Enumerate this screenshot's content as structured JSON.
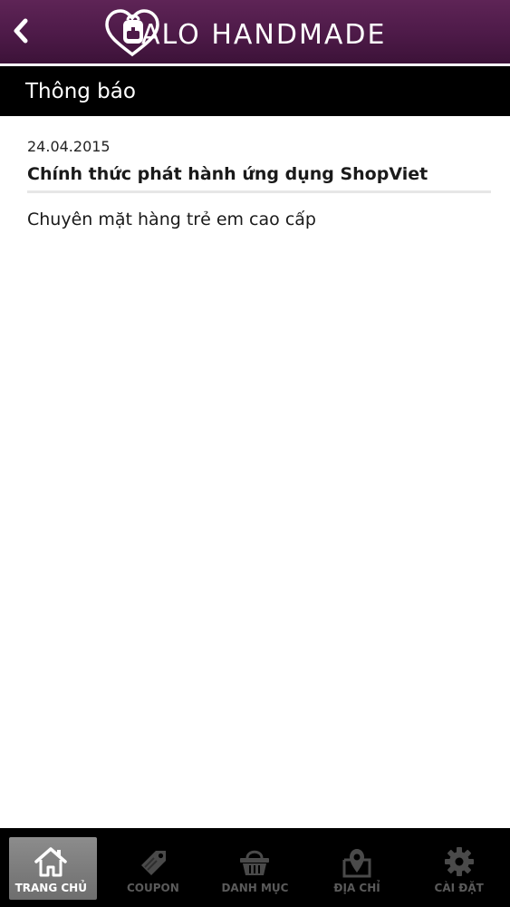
{
  "header": {
    "logo_text": "ALO HANDMADE",
    "logo_icon": "backpack-heart-logo",
    "back_icon": "chevron-left-icon"
  },
  "section": {
    "title": "Thông báo"
  },
  "notices": [
    {
      "date": "24.04.2015",
      "title": "Chính thức phát hành ứng dụng ShopViet",
      "body": "Chuyên mặt hàng trẻ em cao cấp"
    }
  ],
  "tabbar": {
    "active_index": 0,
    "tabs": [
      {
        "label": "TRANG CHỦ",
        "icon": "home-icon"
      },
      {
        "label": "COUPON",
        "icon": "tag-icon"
      },
      {
        "label": "DANH MỤC",
        "icon": "basket-icon"
      },
      {
        "label": "ĐỊA CHỈ",
        "icon": "map-pin-icon"
      },
      {
        "label": "CÀI ĐẶT",
        "icon": "gear-icon"
      }
    ]
  },
  "colors": {
    "header_top": "#5e2456",
    "header_bottom": "#3c1238",
    "section_bar": "#000000",
    "tab_inactive": "#5a5a5a",
    "tab_active_bg": "#7d7d7d"
  }
}
